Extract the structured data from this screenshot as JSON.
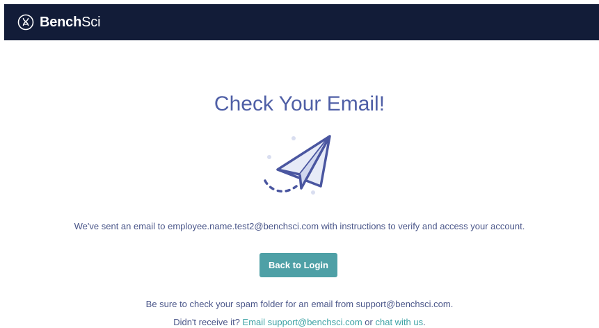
{
  "header": {
    "logo_bold": "Bench",
    "logo_light": "Sci",
    "background_color": "#121c38"
  },
  "main": {
    "title": "Check Your Email!",
    "illustration_icon": "paper-plane-icon",
    "message": "We've sent an email to employee.name.test2@benchsci.com with instructions to verify and access your account.",
    "back_button_label": "Back to Login",
    "spam_note": "Be sure to check your spam folder for an email from support@benchsci.com.",
    "help": {
      "prefix": "Didn't receive it? ",
      "email_link": "Email support@benchsci.com",
      "middle": " or ",
      "chat_link": "chat with us",
      "suffix": "."
    }
  },
  "colors": {
    "accent": "#4ea0a6",
    "title": "#4f5fa6",
    "link": "#3ea3a5",
    "text": "#4a5689"
  }
}
